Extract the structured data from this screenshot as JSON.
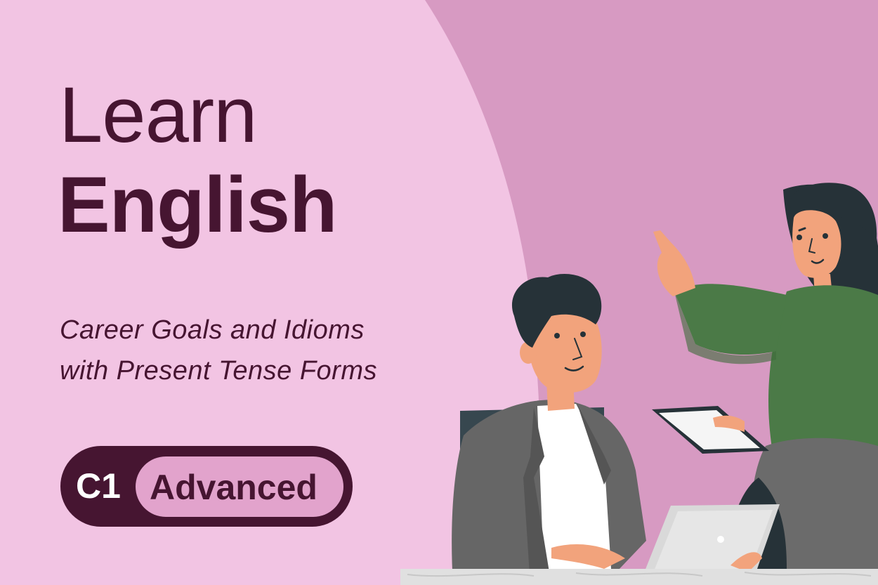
{
  "title": {
    "line1": "Learn",
    "line2": "English"
  },
  "subtitle": {
    "line1": "Career Goals and Idioms",
    "line2": "with Present Tense Forms"
  },
  "level": {
    "code": "C1",
    "name": "Advanced"
  },
  "colors": {
    "background": "#f2c4e3",
    "accent_background": "#d79ac2",
    "text": "#461531",
    "badge_pill": "#e2a3cc"
  },
  "illustration": {
    "subject": "two-colleagues-with-tablets"
  }
}
